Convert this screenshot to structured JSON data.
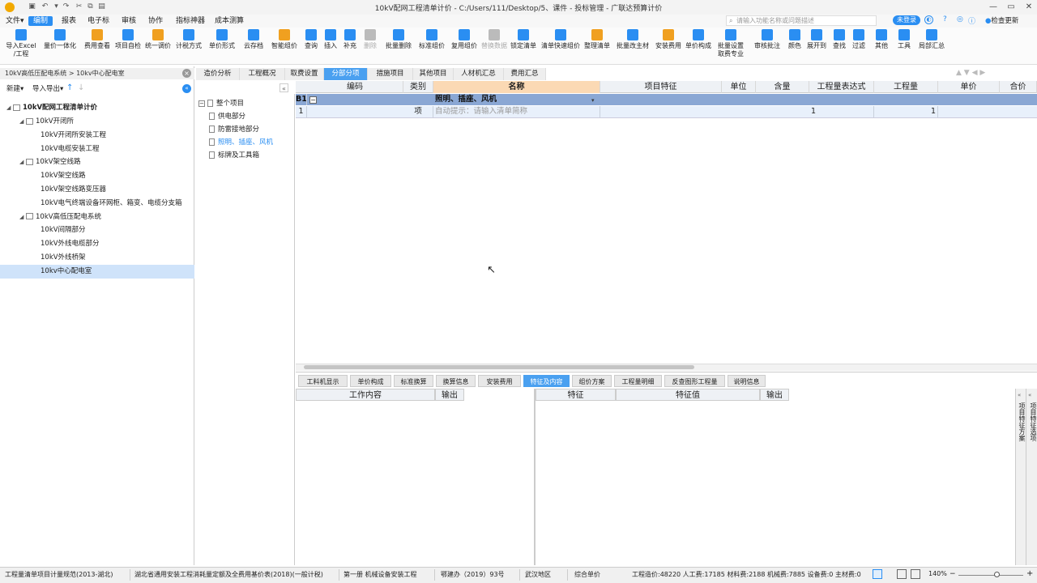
{
  "window": {
    "title": "10kV配网工程清单计价 - C:/Users/111/Desktop/5、课件 - 投标管理 - 广联达预算计价"
  },
  "menu": {
    "items": [
      "文件▾",
      "编制",
      "报表",
      "电子标",
      "审核",
      "协作",
      "指标神器",
      "成本测算"
    ],
    "active_index": 1
  },
  "search": {
    "placeholder": "请输入功能名称或问题描述"
  },
  "login": {
    "label": "未登录"
  },
  "update": {
    "label": "检查更新"
  },
  "toolbar": {
    "buttons": [
      {
        "label": "导入Excel",
        "label2": "/工程",
        "icon": "import-excel-icon",
        "color": "#2a8ef2"
      },
      {
        "label": "量价一体化",
        "icon": "qty-price-icon",
        "color": "#2a8ef2"
      },
      {
        "label": "费用查看",
        "icon": "cost-view-icon",
        "color": "#f0a020"
      },
      {
        "label": "项目自检",
        "icon": "self-check-icon",
        "color": "#2a8ef2"
      },
      {
        "label": "统一调价",
        "icon": "adjust-price-icon",
        "color": "#f0a020"
      },
      {
        "label": "计税方式",
        "icon": "tax-icon",
        "color": "#2a8ef2"
      },
      {
        "label": "单价形式",
        "icon": "unit-price-icon",
        "color": "#2a8ef2"
      },
      {
        "label": "云存档",
        "icon": "cloud-save-icon",
        "color": "#2a8ef2"
      },
      {
        "label": "智能组价",
        "icon": "smart-price-icon",
        "color": "#f0a020"
      },
      {
        "label": "查询",
        "icon": "query-icon",
        "color": "#2a8ef2"
      },
      {
        "label": "插入",
        "icon": "insert-icon",
        "color": "#2a8ef2"
      },
      {
        "label": "补充",
        "icon": "supplement-icon",
        "color": "#2a8ef2"
      },
      {
        "label": "删除",
        "icon": "delete-icon",
        "color": "#bbbbbb",
        "disabled": true
      },
      {
        "label": "批量删除",
        "icon": "batch-delete-icon",
        "color": "#2a8ef2"
      },
      {
        "label": "标准组价",
        "icon": "standard-price-icon",
        "color": "#2a8ef2"
      },
      {
        "label": "复用组价",
        "icon": "reuse-price-icon",
        "color": "#2a8ef2"
      },
      {
        "label": "替换数据",
        "icon": "replace-data-icon",
        "color": "#bbbbbb",
        "disabled": true
      },
      {
        "label": "锁定清单",
        "icon": "lock-icon",
        "color": "#2a8ef2"
      },
      {
        "label": "清单快速组价",
        "icon": "quick-price-icon",
        "color": "#2a8ef2"
      },
      {
        "label": "整理清单",
        "icon": "organize-icon",
        "color": "#f0a020"
      },
      {
        "label": "批量改主材",
        "icon": "batch-material-icon",
        "color": "#2a8ef2"
      },
      {
        "label": "安装费用",
        "icon": "install-cost-icon",
        "color": "#f0a020"
      },
      {
        "label": "单价构成",
        "icon": "price-composition-icon",
        "color": "#2a8ef2"
      },
      {
        "label": "批量设置",
        "label2": "取费专业",
        "icon": "batch-setting-icon",
        "color": "#2a8ef2"
      },
      {
        "label": "审核批注",
        "icon": "review-icon",
        "color": "#2a8ef2"
      },
      {
        "label": "颜色",
        "icon": "color-icon",
        "color": "#2a8ef2"
      },
      {
        "label": "展开到",
        "icon": "expand-icon",
        "color": "#2a8ef2"
      },
      {
        "label": "查找",
        "icon": "find-icon",
        "color": "#2a8ef2"
      },
      {
        "label": "过滤",
        "icon": "filter-icon",
        "color": "#2a8ef2"
      },
      {
        "label": "其他",
        "icon": "other-icon",
        "color": "#2a8ef2"
      },
      {
        "label": "工具",
        "icon": "tool-icon",
        "color": "#2a8ef2"
      },
      {
        "label": "局部汇总",
        "icon": "partial-summary-icon",
        "color": "#2a8ef2"
      }
    ]
  },
  "left": {
    "breadcrumb": "10kV高低压配电系统 > 10kv中心配电室",
    "new_label": "新建▾",
    "import_label": "导入导出▾",
    "root": "10kV配网工程清单计价",
    "tree": [
      {
        "label": "10kV开闭所",
        "level": 1,
        "group": true
      },
      {
        "label": "10kV开闭所安装工程",
        "level": 2
      },
      {
        "label": "10kV电缆安装工程",
        "level": 2
      },
      {
        "label": "10kV架空线路",
        "level": 1,
        "group": true
      },
      {
        "label": "10kV架空线路",
        "level": 2
      },
      {
        "label": "10kV架空线路变压器",
        "level": 2
      },
      {
        "label": "10kV电气终端设备环网柜、箱变、电缆分支箱",
        "level": 2
      },
      {
        "label": "10kV高低压配电系统",
        "level": 1,
        "group": true
      },
      {
        "label": "10kV间隔部分",
        "level": 2
      },
      {
        "label": "10kV外线电缆部分",
        "level": 2
      },
      {
        "label": "10kV外线桥架",
        "level": 2
      },
      {
        "label": "10kv中心配电室",
        "level": 2,
        "selected": true
      }
    ]
  },
  "tabs": [
    "造价分析",
    "工程概况",
    "取费设置",
    "分部分项",
    "措施项目",
    "其他项目",
    "人材机汇总",
    "费用汇总"
  ],
  "active_tab": 3,
  "midtree": {
    "root": "整个项目",
    "items": [
      "供电部分",
      "防雷接地部分",
      "照明、插座、风机",
      "标牌及工具箱"
    ],
    "selected": 2
  },
  "grid": {
    "headers": [
      "编码",
      "类别",
      "名称",
      "项目特征",
      "单位",
      "含量",
      "工程量表达式",
      "工程量",
      "单价",
      "合价"
    ],
    "section": {
      "code": "B1",
      "name": "照明、插座、风机"
    },
    "rows": [
      {
        "no": "1",
        "type": "项",
        "name_hint": "自动提示：请输入清单简称",
        "expr": "1",
        "qty": "1"
      }
    ]
  },
  "bottom": {
    "tabs": [
      "工料机显示",
      "单价构成",
      "标准换算",
      "换算信息",
      "安装费用",
      "特征及内容",
      "组价方案",
      "工程量明细",
      "反查图形工程量",
      "说明信息"
    ],
    "active": 5,
    "left_headers": [
      "工作内容",
      "输出"
    ],
    "right_headers": [
      "特征",
      "特征值",
      "输出"
    ],
    "side_labels": [
      "项目特征方案",
      "项目特征选项"
    ]
  },
  "status": {
    "items": [
      "工程量清单项目计量规范(2013-湖北)",
      "湖北省通用安装工程消耗量定额及全费用基价表(2018)(一般计税)",
      "第一册 机械设备安装工程",
      "鄂建办（2019）93号",
      "武汉地区",
      "综合单价"
    ],
    "costs": "工程造价:48220  人工费:17185  材料费:2188  机械费:7885  设备费:0  主材费:0",
    "zoom": "140%"
  }
}
